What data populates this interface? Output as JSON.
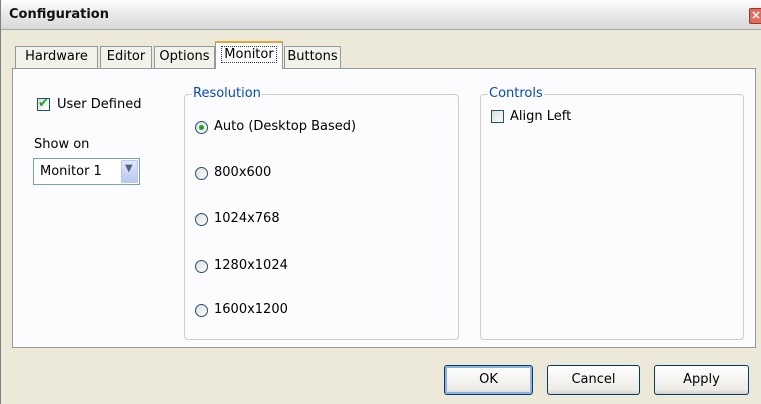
{
  "window": {
    "title": "Configuration",
    "close_glyph": "×"
  },
  "tabs": [
    {
      "label": "Hardware",
      "active": false
    },
    {
      "label": "Editor",
      "active": false
    },
    {
      "label": "Options",
      "active": false
    },
    {
      "label": "Monitor",
      "active": true
    },
    {
      "label": "Buttons",
      "active": false
    }
  ],
  "monitor": {
    "user_defined_label": "User Defined",
    "user_defined_checked": true,
    "show_on_label": "Show on",
    "show_on_value": "Monitor 1",
    "resolution": {
      "title": "Resolution",
      "options": [
        "Auto (Desktop Based)",
        "800x600",
        "1024x768",
        "1280x1024",
        "1600x1200"
      ],
      "selected": "Auto (Desktop Based)"
    },
    "controls": {
      "title": "Controls",
      "align_left_label": "Align Left",
      "align_left_checked": false
    }
  },
  "buttons": {
    "ok": "OK",
    "cancel": "Cancel",
    "apply": "Apply"
  },
  "colors": {
    "group_title": "#0046d5",
    "check_mark": "#21a121",
    "active_tab_accent": "#e7a63b"
  },
  "icons": {
    "check": "check-icon",
    "dropdown": "chevron-down-icon",
    "close": "close-icon"
  }
}
